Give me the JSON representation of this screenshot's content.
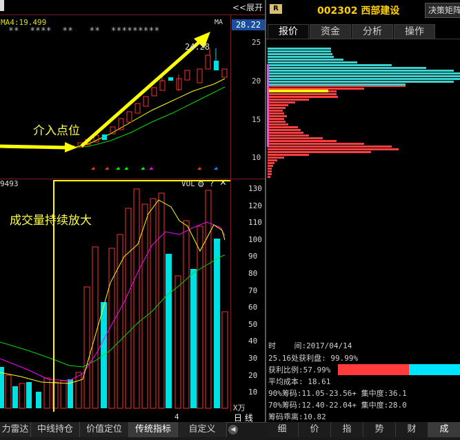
{
  "top_bar": {
    "expand_label": "<<展开",
    "stock_badge": "R",
    "stock_code": "002302",
    "stock_name": "西部建设",
    "right_btn": "决策矩阵"
  },
  "price_chart": {
    "ma_label": "MA4:19.499",
    "star_row": "**  ****  **   **  *********",
    "ma_tag": "MA",
    "current_price": "28.22",
    "peak_label": "24.28",
    "annotation": "介入点位",
    "arrow_color": "#ffff00"
  },
  "price_axis": {
    "ticks": [
      "25",
      "20",
      "15",
      "10"
    ]
  },
  "right_tabs": [
    "报价",
    "资金",
    "分析",
    "操作"
  ],
  "volume_chart": {
    "left_value": "9493",
    "title": "VOL",
    "annotation": "成交量持续放大",
    "axis_unit": "X万",
    "ticks": [
      "130",
      "120",
      "110",
      "100",
      "90",
      "80",
      "70",
      "60",
      "50",
      "40",
      "30",
      "20",
      "10"
    ],
    "x_label": "4",
    "period_label": "日 线"
  },
  "chip_info": {
    "time_label": "时",
    "time_value": "间:2017/04/14",
    "profit_line": "25.16处获利盘: 99.99%",
    "profit_ratio": "获利比例:57.99%",
    "avg_cost": "平均成本: 18.61",
    "line90": "90%筹码:11.05-23.56+ 集中度:36.1",
    "line70": "70%筹码:12.40-22.04+ 集中度:28.0",
    "distance": "筹码乖离:10.82",
    "profit_bar_fraction": 0.58
  },
  "bottom_tabs": [
    "力雷达",
    "中线持仓",
    "价值定位",
    "传统指标",
    "自定义"
  ],
  "bottom_tabs_right": [
    "细",
    "价",
    "指",
    "势",
    "财",
    "成"
  ],
  "colors": {
    "up": "#ff3030",
    "down": "#00e0e0",
    "ma_yellow": "#ffff00",
    "ma_green": "#00ff00",
    "ma_magenta": "#ff00ff",
    "highlight": "#ffff00"
  }
}
